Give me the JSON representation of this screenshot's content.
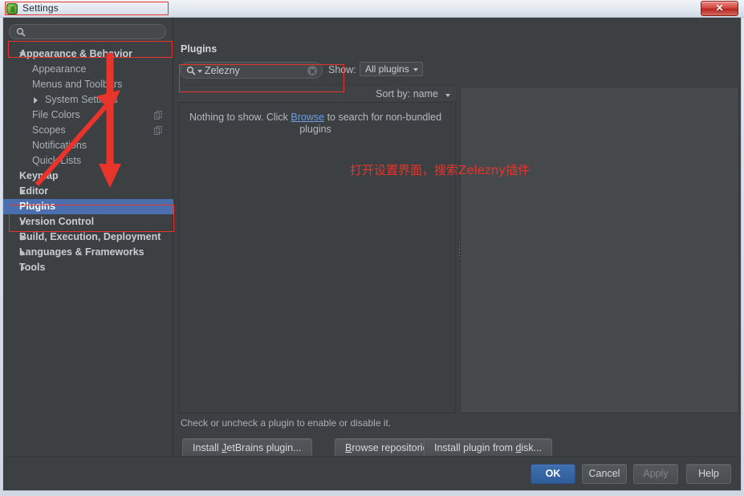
{
  "window": {
    "title": "Settings",
    "title_icon": "intellij-logo-icon",
    "close_label": "✕",
    "frame_color": "#c2cbd6"
  },
  "sidebar": {
    "search": {
      "value": "",
      "placeholder": "",
      "icon": "search-icon"
    },
    "items": [
      {
        "label": "Appearance & Behavior",
        "level": 0,
        "arrow": "down",
        "bold": true,
        "selected": false
      },
      {
        "label": "Appearance",
        "level": 1,
        "arrow": "none",
        "bold": false,
        "selected": false
      },
      {
        "label": "Menus and Toolbars",
        "level": 1,
        "arrow": "none",
        "bold": false,
        "selected": false
      },
      {
        "label": "System Settings",
        "level": 1,
        "arrow": "right",
        "bold": false,
        "selected": false
      },
      {
        "label": "File Colors",
        "level": 1,
        "arrow": "none",
        "bold": false,
        "selected": false,
        "badge": "copy-icon"
      },
      {
        "label": "Scopes",
        "level": 1,
        "arrow": "none",
        "bold": false,
        "selected": false,
        "badge": "copy-icon"
      },
      {
        "label": "Notifications",
        "level": 1,
        "arrow": "none",
        "bold": false,
        "selected": false
      },
      {
        "label": "Quick Lists",
        "level": 1,
        "arrow": "none",
        "bold": false,
        "selected": false
      },
      {
        "label": "Keymap",
        "level": 0,
        "arrow": "none",
        "bold": true,
        "selected": false
      },
      {
        "label": "Editor",
        "level": 0,
        "arrow": "right",
        "bold": true,
        "selected": false
      },
      {
        "label": "Plugins",
        "level": 0,
        "arrow": "none",
        "bold": true,
        "selected": true
      },
      {
        "label": "Version Control",
        "level": 0,
        "arrow": "right",
        "bold": true,
        "selected": false
      },
      {
        "label": "Build, Execution, Deployment",
        "level": 0,
        "arrow": "right",
        "bold": true,
        "selected": false
      },
      {
        "label": "Languages & Frameworks",
        "level": 0,
        "arrow": "right",
        "bold": true,
        "selected": false
      },
      {
        "label": "Tools",
        "level": 0,
        "arrow": "right",
        "bold": true,
        "selected": false
      }
    ],
    "selected_color": "#4b6eaf"
  },
  "panel": {
    "title": "Plugins",
    "search": {
      "value": "Zelezny",
      "icon": "search-icon",
      "dropdown_icon": "chevron-down-icon",
      "clear_icon": "clear-circle-icon"
    },
    "show": {
      "label": "Show:",
      "value": "All plugins",
      "caret": "chevron-down-icon"
    },
    "sort": {
      "label": "Sort by: name",
      "caret": "chevron-down-icon"
    },
    "empty_message": {
      "before": "Nothing to show. Click ",
      "link": "Browse",
      "after": " to search for non-bundled plugins"
    },
    "hint": "Check or uncheck a plugin to enable or disable it.",
    "buttons": {
      "jetbrains": {
        "pre": "Install ",
        "mnemonic": "J",
        "post": "etBrains plugin..."
      },
      "browse_repositories": {
        "pre": "",
        "mnemonic": "B",
        "post": "rowse repositories..."
      },
      "from_disk": {
        "pre": "Install plugin from ",
        "mnemonic": "d",
        "post": "isk..."
      }
    }
  },
  "footer": {
    "ok": "OK",
    "cancel": "Cancel",
    "apply": "Apply",
    "help": "Help"
  },
  "annotations": {
    "note_text": "打开设置界面，搜索Zelezny插件",
    "color": "#e8342a",
    "boxes": [
      "titlebar-highlight",
      "sidebar-search-highlight",
      "plugins-item-highlight",
      "plugin-search-highlight"
    ],
    "arrows": [
      "down-arrow-to-plugins",
      "diagonal-arrow-to-search"
    ]
  }
}
